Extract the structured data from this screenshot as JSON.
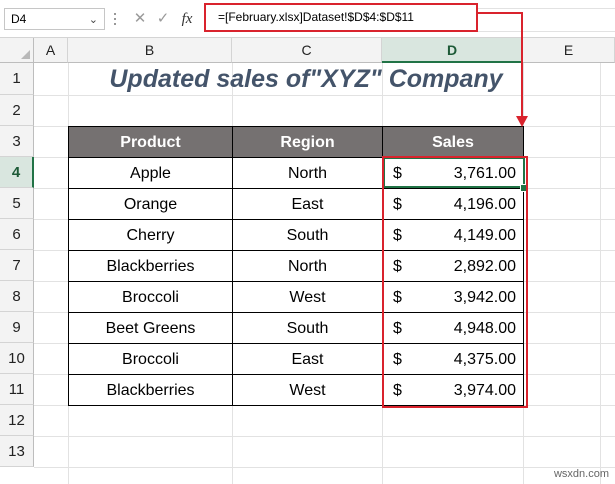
{
  "formula_bar": {
    "name_box": "D4",
    "cancel_symbol": "✕",
    "enter_symbol": "✓",
    "fx_label": "fx",
    "formula": "=[February.xlsx]Dataset!$D$4:$D$11"
  },
  "columns": [
    "A",
    "B",
    "C",
    "D",
    "E"
  ],
  "rows": [
    "1",
    "2",
    "3",
    "4",
    "5",
    "6",
    "7",
    "8",
    "9",
    "10",
    "11",
    "12",
    "13"
  ],
  "selected": {
    "column": "D",
    "row": "4"
  },
  "sheet": {
    "title": "Updated sales of\"XYZ\" Company",
    "headers": {
      "product": "Product",
      "region": "Region",
      "sales": "Sales"
    },
    "records": [
      {
        "product": "Apple",
        "region": "North",
        "currency": "$",
        "sales": "3,761.00"
      },
      {
        "product": "Orange",
        "region": "East",
        "currency": "$",
        "sales": "4,196.00"
      },
      {
        "product": "Cherry",
        "region": "South",
        "currency": "$",
        "sales": "4,149.00"
      },
      {
        "product": "Blackberries",
        "region": "North",
        "currency": "$",
        "sales": "2,892.00"
      },
      {
        "product": "Broccoli",
        "region": "West",
        "currency": "$",
        "sales": "3,942.00"
      },
      {
        "product": "Beet Greens",
        "region": "South",
        "currency": "$",
        "sales": "4,948.00"
      },
      {
        "product": "Broccoli",
        "region": "East",
        "currency": "$",
        "sales": "4,375.00"
      },
      {
        "product": "Blackberries",
        "region": "West",
        "currency": "$",
        "sales": "3,974.00"
      }
    ]
  },
  "colors": {
    "header_fill": "#757171",
    "title_color": "#44546a",
    "highlight_red": "#d9232d",
    "selection_green": "#217346"
  },
  "watermark": "wsxdn.com"
}
